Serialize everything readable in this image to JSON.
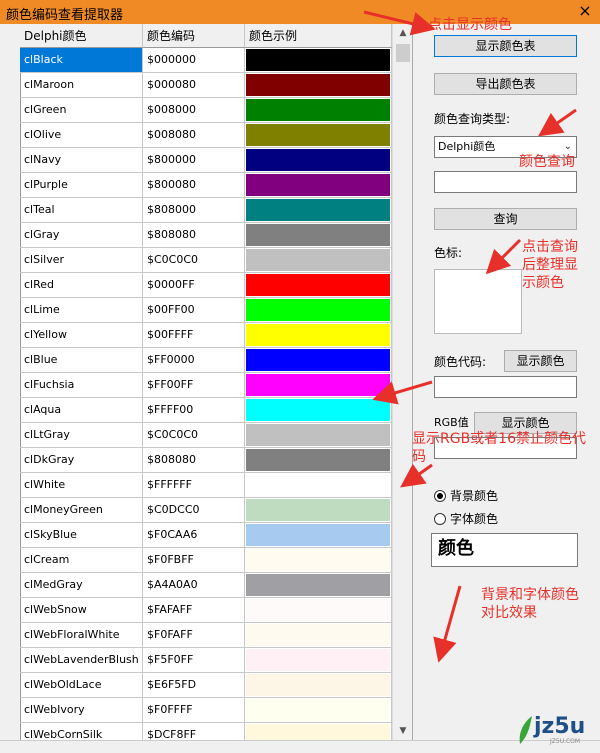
{
  "window": {
    "title": "颜色编码查看提取器",
    "close_glyph": "×"
  },
  "table": {
    "columns": [
      "Delphi颜色",
      "颜色编码",
      "颜色示例"
    ],
    "selected_index": 0,
    "rows": [
      {
        "name": "clBlack",
        "code": "$000000",
        "color": "#000000"
      },
      {
        "name": "clMaroon",
        "code": "$000080",
        "color": "#800000"
      },
      {
        "name": "clGreen",
        "code": "$008000",
        "color": "#008000"
      },
      {
        "name": "clOlive",
        "code": "$008080",
        "color": "#808000"
      },
      {
        "name": "clNavy",
        "code": "$800000",
        "color": "#000080"
      },
      {
        "name": "clPurple",
        "code": "$800080",
        "color": "#800080"
      },
      {
        "name": "clTeal",
        "code": "$808000",
        "color": "#008080"
      },
      {
        "name": "clGray",
        "code": "$808080",
        "color": "#808080"
      },
      {
        "name": "clSilver",
        "code": "$C0C0C0",
        "color": "#C0C0C0"
      },
      {
        "name": "clRed",
        "code": "$0000FF",
        "color": "#FF0000"
      },
      {
        "name": "clLime",
        "code": "$00FF00",
        "color": "#00FF00"
      },
      {
        "name": "clYellow",
        "code": "$00FFFF",
        "color": "#FFFF00"
      },
      {
        "name": "clBlue",
        "code": "$FF0000",
        "color": "#0000FF"
      },
      {
        "name": "clFuchsia",
        "code": "$FF00FF",
        "color": "#FF00FF"
      },
      {
        "name": "clAqua",
        "code": "$FFFF00",
        "color": "#00FFFF"
      },
      {
        "name": "clLtGray",
        "code": "$C0C0C0",
        "color": "#C0C0C0"
      },
      {
        "name": "clDkGray",
        "code": "$808080",
        "color": "#808080"
      },
      {
        "name": "clWhite",
        "code": "$FFFFFF",
        "color": "#FFFFFF"
      },
      {
        "name": "clMoneyGreen",
        "code": "$C0DCC0",
        "color": "#C0DCC0"
      },
      {
        "name": "clSkyBlue",
        "code": "$F0CAA6",
        "color": "#A6CAF0"
      },
      {
        "name": "clCream",
        "code": "$F0FBFF",
        "color": "#FFFBF0"
      },
      {
        "name": "clMedGray",
        "code": "$A4A0A0",
        "color": "#A0A0A4"
      },
      {
        "name": "clWebSnow",
        "code": "$FAFAFF",
        "color": "#FFFAFA"
      },
      {
        "name": "clWebFloralWhite",
        "code": "$F0FAFF",
        "color": "#FFFAF0"
      },
      {
        "name": "clWebLavenderBlush",
        "code": "$F5F0FF",
        "color": "#FFF0F5"
      },
      {
        "name": "clWebOldLace",
        "code": "$E6F5FD",
        "color": "#FDF5E6"
      },
      {
        "name": "clWebIvory",
        "code": "$F0FFFF",
        "color": "#FFFFF0"
      },
      {
        "name": "clWebCornSilk",
        "code": "$DCF8FF",
        "color": "#FFF8DC"
      }
    ]
  },
  "panel": {
    "show_table_button": "显示颜色表",
    "export_table_button": "导出颜色表",
    "query_type_label": "颜色查询类型:",
    "query_type_value": "Delphi颜色",
    "query_input_value": "",
    "query_button": "查询",
    "swatch_label": "色标:",
    "color_code_label": "颜色代码:",
    "show_color_button_1": "显示颜色",
    "color_code_value": "",
    "rgb_label": "RGB值",
    "show_color_button_2": "显示颜色",
    "rgb_value": "",
    "radio_background": "背景颜色",
    "radio_font": "字体颜色",
    "sample_text": "颜色"
  },
  "annotations": {
    "note_show": "点击显示颜色",
    "note_query": "颜色查询",
    "note_click_query": [
      "点击查询",
      "后整理显",
      "示颜色"
    ],
    "note_rgb": [
      "显示RGB或者16禁止颜色代",
      "码"
    ],
    "note_contrast": [
      "背景和字体颜色",
      "对比效果"
    ],
    "color": "#e8302a"
  },
  "watermark": {
    "text": "jz5u",
    "sub": "JZ5U.COM",
    "leaf_color": "#3aa63a"
  }
}
